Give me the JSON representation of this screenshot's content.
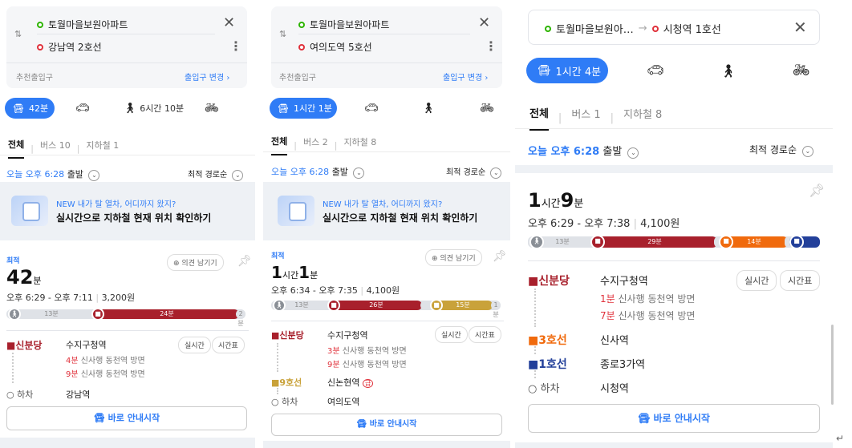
{
  "p0": {
    "origin": "토월마을보원아파트",
    "destination": "강남역 2호선",
    "entrance_label": "추천출입구",
    "entrance_change": "출입구 변경 ›",
    "mode_transit": "42분",
    "mode_walk": "6시간 10분",
    "tab_all": "전체",
    "tab_bus": "버스 10",
    "tab_subway": "지하철 1",
    "depart_prefix": "오늘 오후 6:28",
    "depart_suffix": "출발",
    "sort": "최적 경로순",
    "banner_line1": "NEW 내가 탈 열차, 어디까지 왔지?",
    "banner_line2": "실시간으로 지하철 현재 위치 확인하기",
    "best_badge": "최적",
    "feedback": "의견 남기기",
    "duration_num": "42",
    "duration_unit": "분",
    "times": "오후 6:29 - 오후 7:11",
    "fare": "3,200원",
    "seg_walk": "13분",
    "seg_line": "24분",
    "seg_end": "2분",
    "step1_line": "신분당",
    "step1_station": "수지구청역",
    "step1_realtime": "실시간",
    "step1_timetable": "시간표",
    "step1_info1_min": "4분",
    "step1_info1_rest": "신사행  동천역 방면",
    "step1_info2_min": "9분",
    "step1_info2_rest": "신사행  동천역 방면",
    "alight_label": "하차",
    "alight_station": "강남역",
    "go_button": "바로 안내시작"
  },
  "p1": {
    "origin": "토월마을보원아파트",
    "destination": "여의도역 5호선",
    "entrance_label": "추천출입구",
    "entrance_change": "출입구 변경 ›",
    "mode_transit": "1시간 1분",
    "tab_all": "전체",
    "tab_bus": "버스 2",
    "tab_subway": "지하철 8",
    "depart_prefix": "오늘 오후 6:28",
    "depart_suffix": "출발",
    "sort": "최적 경로순",
    "banner_line1": "NEW 내가 탈 열차, 어디까지 왔지?",
    "banner_line2": "실시간으로 지하철 현재 위치 확인하기",
    "best_badge": "최적",
    "feedback": "의견 남기기",
    "duration_h": "1",
    "duration_h_unit": "시간",
    "duration_m": "1",
    "duration_m_unit": "분",
    "times": "오후 6:34 - 오후 7:35",
    "fare": "4,100원",
    "seg_walk": "13분",
    "seg_line": "26분",
    "seg_line2": "15분",
    "seg_end": "1분",
    "step1_line": "신분당",
    "step1_station": "수지구청역",
    "step1_realtime": "실시간",
    "step1_timetable": "시간표",
    "step1_info1_min": "3분",
    "step1_info1_rest": "신사행  동천역 방면",
    "step1_info2_min": "9분",
    "step1_info2_rest": "신사행  동천역 방면",
    "step2_line": "9호선",
    "step2_station": "신논현역",
    "step2_badge": "급",
    "alight_label": "하차",
    "alight_station": "여의도역",
    "go_button": "바로 안내시작"
  },
  "p2": {
    "origin": "토월마을보원아…",
    "arrow": "→",
    "destination": "시청역 1호선",
    "mode_transit": "1시간 4분",
    "tab_all": "전체",
    "tab_bus": "버스 1",
    "tab_subway": "지하철 8",
    "depart_prefix": "오늘 오후 6:28",
    "depart_suffix": "출발",
    "sort": "최적 경로순",
    "duration_h": "1",
    "duration_h_unit": "시간",
    "duration_m": "9",
    "duration_m_unit": "분",
    "times": "오후 6:29 - 오후 7:38",
    "fare": "4,100원",
    "seg_walk": "13분",
    "seg_line": "29분",
    "seg_line2": "14분",
    "step1_line": "신분당",
    "step1_station": "수지구청역",
    "step1_realtime": "실시간",
    "step1_timetable": "시간표",
    "step1_info1_min": "1분",
    "step1_info1_rest": "신사행  동천역 방면",
    "step1_info2_min": "7분",
    "step1_info2_rest": "신사행  동천역 방면",
    "step2_line": "3호선",
    "step2_station": "신사역",
    "step3_line": "1호선",
    "step3_station": "종로3가역",
    "alight_label": "하차",
    "alight_station": "시청역",
    "go_button": "바로 안내시작"
  },
  "colors": {
    "accent": "#2f7cf6",
    "shinbundang": "#a8202c",
    "line9": "#c9a23a",
    "line3": "#f06a0d",
    "line1": "#23409a"
  }
}
